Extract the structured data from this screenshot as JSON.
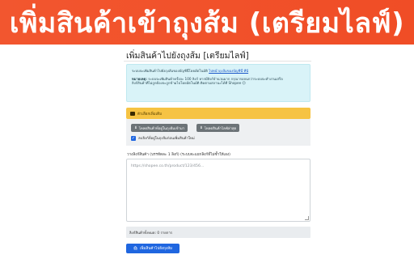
{
  "banner": {
    "title": "เพิ่มสินค้าเข้าถุงส้ม (เตรียมไลฟ์)"
  },
  "page": {
    "title": "เพิ่มสินค้าไปยังถุงส้ม [เตรียมไลฟ์]"
  },
  "info": {
    "line1": "ระบบจะเพิ่มสินค้าไปยังถุงส้มของบัญชีนี้โดยอัตโนมัติ",
    "line1_link": "ไปหน้าถุงส้มของบัญชีนี้ ที่นี่",
    "line2_bold": "หมายเหตุ:",
    "line2": "ระบบจะเพิ่มสินค้าครั้งละ 100 ลิงก์ หากมีลิงก์จำนวนมาก กรุณารอจนกว่าระบบจะทำงานเสร็จ",
    "line3": "ลิงก์สินค้าที่ไม่ถูกต้องจะถูกข้ามไปโดยอัตโนมัติ ติดตามสถานะได้ที่ Shopee 😊"
  },
  "warning": {
    "text": "ตัวเลือกเพิ่มเติม"
  },
  "buttons": {
    "load_label": "โหลดสินค้าที่อยู่ในถุงส้มเข้ามา",
    "clear_label": "โหลดสินค้าไลฟ์ล่าสุด"
  },
  "checkbox": {
    "label": "ลบลิงก์ที่อยู่ในถุงส้มก่อนเพิ่มสินค้าใหม่",
    "checked": true
  },
  "textarea": {
    "label": "วางลิงก์สินค้า (บรรทัดละ 1 ลิงก์) (ระบบจะแยกลิงก์ที่ไม่ซ้ำให้เอง)",
    "placeholder": "https://shopee.co.th/product/123/456..."
  },
  "status": {
    "count_text": "ลิงก์สินค้าทั้งหมด: 0 รายการ"
  },
  "submit": {
    "label": "เพิ่มสินค้าไปยังถุงส้ม"
  },
  "colors": {
    "banner": "#f04d26",
    "primary": "#1f66e0",
    "warning": "#f6c343",
    "info": "#d9f3f8"
  },
  "icons": {
    "warning": "card-icon",
    "download": "download-icon",
    "submit": "bag-icon"
  }
}
